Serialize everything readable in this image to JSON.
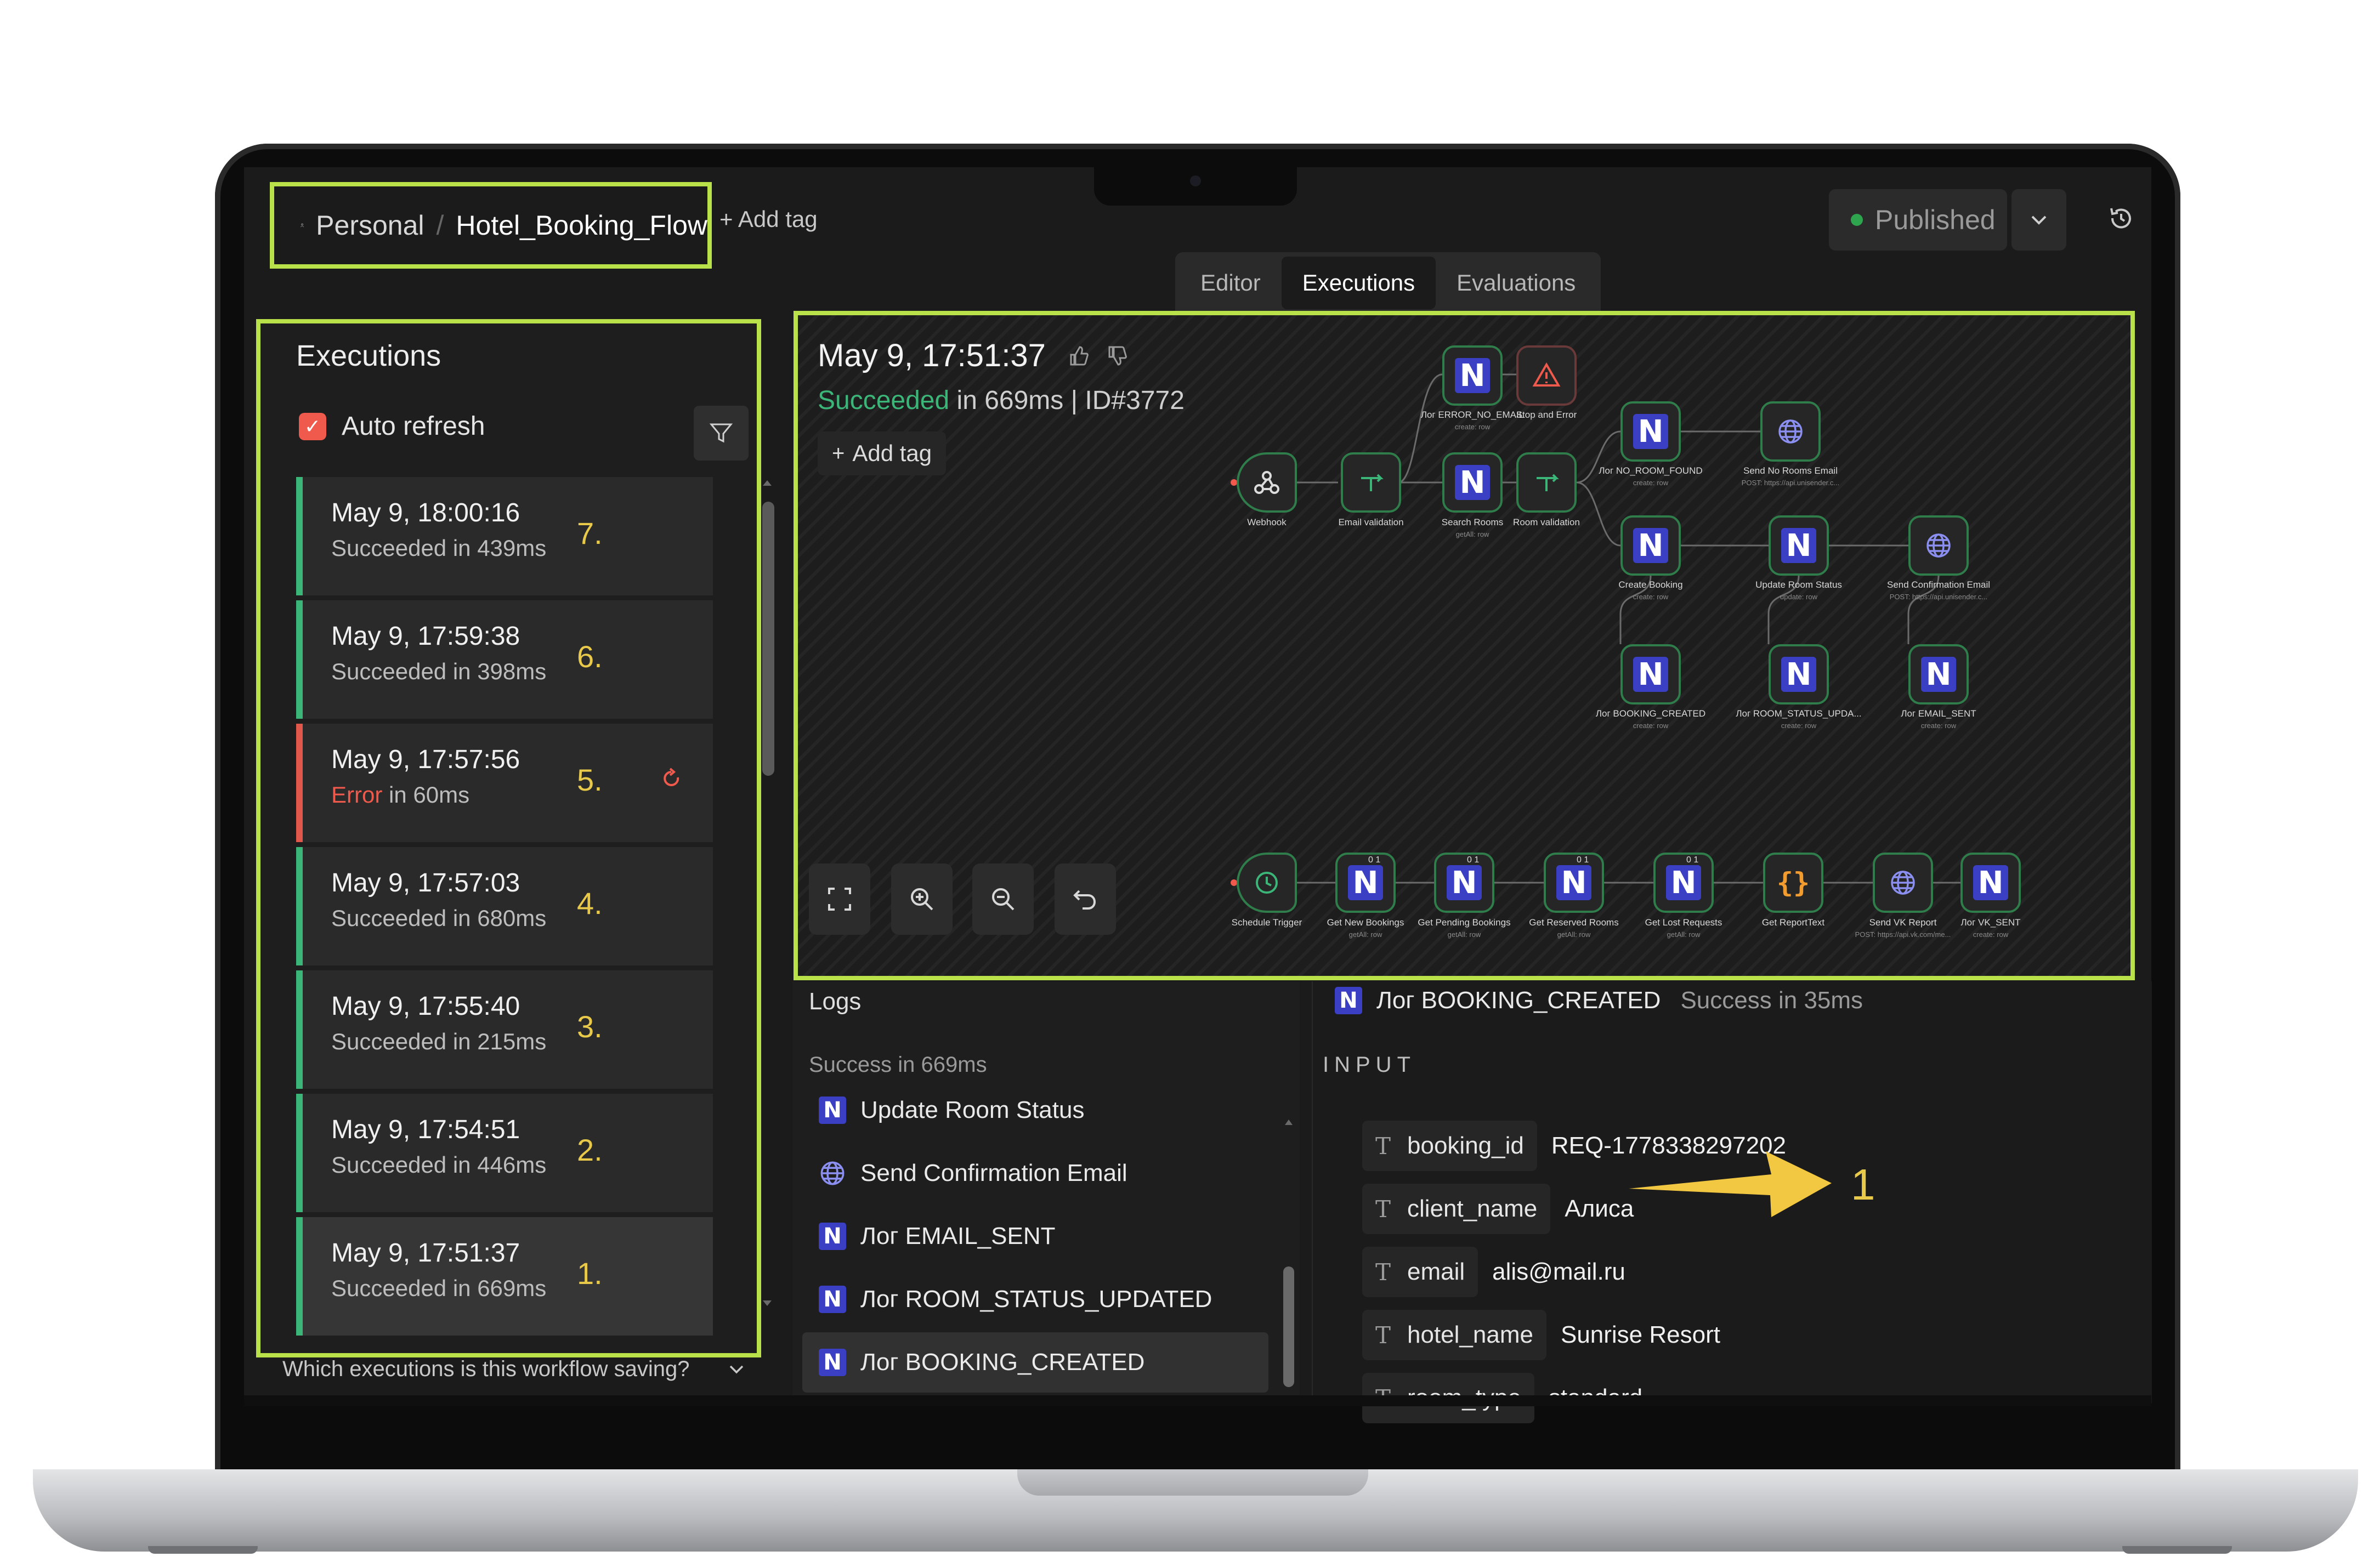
{
  "header": {
    "workspace": "Personal",
    "workflow_name": "Hotel_Booking_Flow",
    "add_tag": "+ Add tag",
    "status": "Published",
    "tabs": [
      "Editor",
      "Executions",
      "Evaluations"
    ],
    "active_tab": "Executions"
  },
  "sidebar": {
    "title": "Executions",
    "auto_refresh_label": "Auto refresh",
    "auto_refresh_checked": true,
    "items": [
      {
        "date": "May 9, 18:00:16",
        "state": "Succeeded",
        "duration": "in 439ms",
        "annotation": "7."
      },
      {
        "date": "May 9, 17:59:38",
        "state": "Succeeded",
        "duration": "in 398ms",
        "annotation": "6."
      },
      {
        "date": "May 9, 17:57:56",
        "state": "Error",
        "duration": "in 60ms",
        "annotation": "5."
      },
      {
        "date": "May 9, 17:57:03",
        "state": "Succeeded",
        "duration": "in 680ms",
        "annotation": "4."
      },
      {
        "date": "May 9, 17:55:40",
        "state": "Succeeded",
        "duration": "in 215ms",
        "annotation": "3."
      },
      {
        "date": "May 9, 17:54:51",
        "state": "Succeeded",
        "duration": "in 446ms",
        "annotation": "2."
      },
      {
        "date": "May 9, 17:51:37",
        "state": "Succeeded",
        "duration": "in 669ms",
        "annotation": "1."
      }
    ],
    "footer_question": "Which executions is this workflow saving?"
  },
  "canvas": {
    "run_date": "May 9, 17:51:37",
    "run_state": "Succeeded",
    "run_detail": " in 669ms | ID#3772",
    "add_tag": "Add tag",
    "nodes": {
      "webhook": {
        "label": "Webhook",
        "sub": ""
      },
      "email_validation": {
        "label": "Email validation",
        "sub": ""
      },
      "log_error_no_email": {
        "label": "Лог ERROR_NO_EMAIL",
        "sub": "create: row"
      },
      "stop_and_error": {
        "label": "Stop and Error",
        "sub": ""
      },
      "search_rooms": {
        "label": "Search Rooms",
        "sub": "getAll: row"
      },
      "room_validation": {
        "label": "Room validation",
        "sub": ""
      },
      "log_no_room_found": {
        "label": "Лог NO_ROOM_FOUND",
        "sub": "create: row"
      },
      "send_no_rooms_email": {
        "label": "Send No Rooms Email",
        "sub": "POST: https://api.unisender.c..."
      },
      "create_booking": {
        "label": "Create Booking",
        "sub": "create: row"
      },
      "update_room_status": {
        "label": "Update Room Status",
        "sub": "update: row"
      },
      "send_confirmation_email": {
        "label": "Send Confirmation Email",
        "sub": "POST: https://api.unisender.c..."
      },
      "log_booking_created": {
        "label": "Лог BOOKING_CREATED",
        "sub": "create: row"
      },
      "log_room_status_upda": {
        "label": "Лог ROOM_STATUS_UPDA...",
        "sub": "create: row"
      },
      "log_email_sent": {
        "label": "Лог EMAIL_SENT",
        "sub": "create: row"
      },
      "schedule_trigger": {
        "label": "Schedule Trigger",
        "sub": ""
      },
      "get_new_bookings": {
        "label": "Get New Bookings",
        "sub": "getAll: row"
      },
      "get_pending_bookings": {
        "label": "Get Pending Bookings",
        "sub": "getAll: row"
      },
      "get_reserved_rooms": {
        "label": "Get Reserved Rooms",
        "sub": "getAll: row"
      },
      "get_lost_requests": {
        "label": "Get Lost Requests",
        "sub": "getAll: row"
      },
      "get_report_text": {
        "label": "Get ReportText",
        "sub": ""
      },
      "send_vk_report": {
        "label": "Send VK Report",
        "sub": "POST: https://api.vk.com/me..."
      },
      "log_vk_sent": {
        "label": "Лог VK_SENT",
        "sub": "create: row"
      }
    },
    "badge": "0 1"
  },
  "logs": {
    "title": "Logs",
    "summary": "Success in 669ms",
    "items": [
      {
        "label": "Update Room Status",
        "icon": "n-icon"
      },
      {
        "label": "Send Confirmation Email",
        "icon": "globe-icon"
      },
      {
        "label": "Лог EMAIL_SENT",
        "icon": "n-icon"
      },
      {
        "label": "Лог ROOM_STATUS_UPDATED",
        "icon": "n-icon"
      },
      {
        "label": "Лог BOOKING_CREATED",
        "icon": "n-icon"
      }
    ]
  },
  "detail": {
    "node": "Лог BOOKING_CREATED",
    "status": "Success in 35ms",
    "section": "INPUT",
    "fields": [
      {
        "key": "booking_id",
        "value": "REQ-1778338297202"
      },
      {
        "key": "client_name",
        "value": "Алиса"
      },
      {
        "key": "email",
        "value": "alis@mail.ru"
      },
      {
        "key": "hotel_name",
        "value": "Sunrise Resort"
      },
      {
        "key": "room_type",
        "value": "standard"
      }
    ],
    "type_glyph": "T",
    "annotation": "1"
  },
  "colors": {
    "accent_highlight": "#b9e24a",
    "success": "#3bb678",
    "error": "#ef5a4c",
    "annotation": "#e8c94a",
    "n_icon": "#3b3fc4"
  }
}
